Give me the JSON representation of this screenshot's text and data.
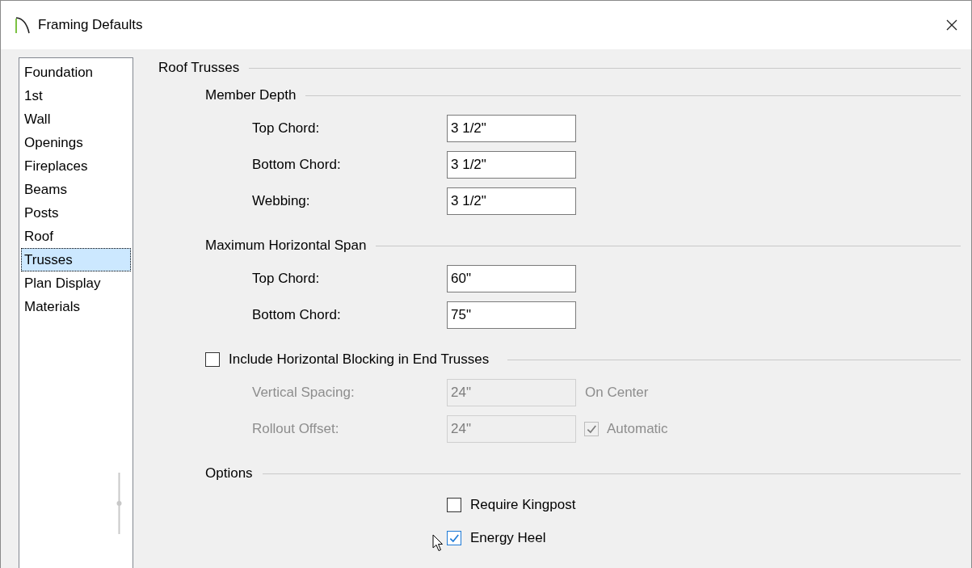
{
  "window": {
    "title": "Framing Defaults"
  },
  "sidebar": {
    "items": [
      {
        "label": "Foundation",
        "selected": false
      },
      {
        "label": "1st",
        "selected": false
      },
      {
        "label": "Wall",
        "selected": false
      },
      {
        "label": "Openings",
        "selected": false
      },
      {
        "label": "Fireplaces",
        "selected": false
      },
      {
        "label": "Beams",
        "selected": false
      },
      {
        "label": "Posts",
        "selected": false
      },
      {
        "label": "Roof",
        "selected": false
      },
      {
        "label": "Trusses",
        "selected": true
      },
      {
        "label": "Plan Display",
        "selected": false
      },
      {
        "label": "Materials",
        "selected": false
      }
    ]
  },
  "panel": {
    "title": "Roof Trusses",
    "groups": [
      {
        "kind": "fields",
        "title": "Member Depth",
        "fields": [
          {
            "label": "Top Chord:",
            "value": "3 1/2\"",
            "disabled": false
          },
          {
            "label": "Bottom Chord:",
            "value": "3 1/2\"",
            "disabled": false
          },
          {
            "label": "Webbing:",
            "value": "3 1/2\"",
            "disabled": false
          }
        ]
      },
      {
        "kind": "fields",
        "title": "Maximum Horizontal Span",
        "fields": [
          {
            "label": "Top Chord:",
            "value": "60\"",
            "disabled": false
          },
          {
            "label": "Bottom Chord:",
            "value": "75\"",
            "disabled": false
          }
        ]
      },
      {
        "kind": "checkgroup",
        "title": "Include Horizontal Blocking in End Trusses",
        "checked": false,
        "fields": [
          {
            "label": "Vertical Spacing:",
            "value": "24\"",
            "disabled": true,
            "suffix": {
              "kind": "text",
              "label": "On Center"
            }
          },
          {
            "label": "Rollout Offset:",
            "value": "24\"",
            "disabled": true,
            "suffix": {
              "kind": "checkbox",
              "label": "Automatic",
              "checked": true
            }
          }
        ]
      },
      {
        "kind": "options",
        "title": "Options",
        "options": [
          {
            "label": "Require Kingpost",
            "checked": false
          },
          {
            "label": "Energy Heel",
            "checked": true
          }
        ]
      }
    ]
  }
}
